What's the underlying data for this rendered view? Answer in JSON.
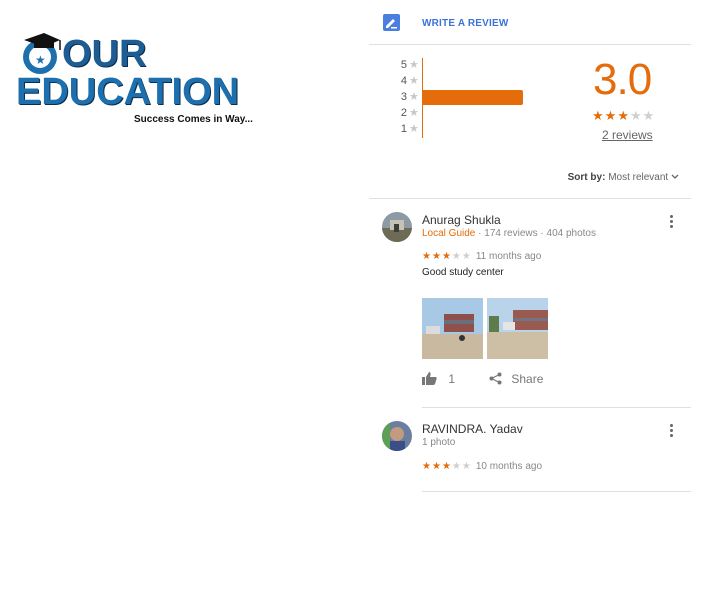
{
  "logo": {
    "line1": "OUR",
    "line2": "EDUCATION",
    "tagline": "Success Comes in Way..."
  },
  "actions": {
    "write_review": "WRITE A REVIEW",
    "write_icon": "pencil-edit-icon"
  },
  "histogram": {
    "rows": [
      {
        "stars": "5",
        "count_fraction": 0
      },
      {
        "stars": "4",
        "count_fraction": 0
      },
      {
        "stars": "3",
        "count_fraction": 1
      },
      {
        "stars": "2",
        "count_fraction": 0
      },
      {
        "stars": "1",
        "count_fraction": 0
      }
    ],
    "bar_color": "#e46c0a"
  },
  "summary": {
    "rating": "3.0",
    "stars_filled": 3,
    "review_count": "2 reviews"
  },
  "sort": {
    "label": "Sort by:",
    "value": "Most relevant"
  },
  "reviews": [
    {
      "name": "Anurag Shukla",
      "badge": "Local Guide",
      "meta": "· 174 reviews · 404 photos",
      "stars_filled": 3,
      "time": "11 months ago",
      "text": "Good study center",
      "likes": "1",
      "share_label": "Share"
    },
    {
      "name": "RAVINDRA. Yadav",
      "meta": "1 photo",
      "stars_filled": 3,
      "time": "10 months ago"
    }
  ],
  "colors": {
    "accent": "#e46c0a",
    "link": "#3b73d6",
    "logo_blue": "#1d6fae"
  }
}
